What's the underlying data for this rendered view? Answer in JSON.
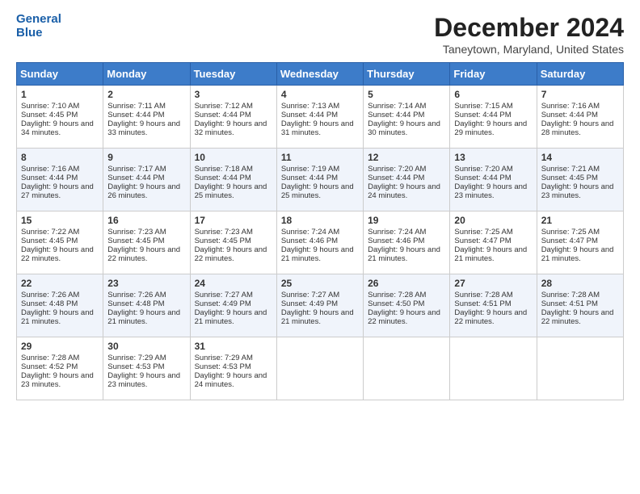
{
  "logo": {
    "line1": "General",
    "line2": "Blue"
  },
  "title": "December 2024",
  "location": "Taneytown, Maryland, United States",
  "days_of_week": [
    "Sunday",
    "Monday",
    "Tuesday",
    "Wednesday",
    "Thursday",
    "Friday",
    "Saturday"
  ],
  "weeks": [
    [
      {
        "day": 1,
        "sunrise": "7:10 AM",
        "sunset": "4:45 PM",
        "daylight": "9 hours and 34 minutes."
      },
      {
        "day": 2,
        "sunrise": "7:11 AM",
        "sunset": "4:44 PM",
        "daylight": "9 hours and 33 minutes."
      },
      {
        "day": 3,
        "sunrise": "7:12 AM",
        "sunset": "4:44 PM",
        "daylight": "9 hours and 32 minutes."
      },
      {
        "day": 4,
        "sunrise": "7:13 AM",
        "sunset": "4:44 PM",
        "daylight": "9 hours and 31 minutes."
      },
      {
        "day": 5,
        "sunrise": "7:14 AM",
        "sunset": "4:44 PM",
        "daylight": "9 hours and 30 minutes."
      },
      {
        "day": 6,
        "sunrise": "7:15 AM",
        "sunset": "4:44 PM",
        "daylight": "9 hours and 29 minutes."
      },
      {
        "day": 7,
        "sunrise": "7:16 AM",
        "sunset": "4:44 PM",
        "daylight": "9 hours and 28 minutes."
      }
    ],
    [
      {
        "day": 8,
        "sunrise": "7:16 AM",
        "sunset": "4:44 PM",
        "daylight": "9 hours and 27 minutes."
      },
      {
        "day": 9,
        "sunrise": "7:17 AM",
        "sunset": "4:44 PM",
        "daylight": "9 hours and 26 minutes."
      },
      {
        "day": 10,
        "sunrise": "7:18 AM",
        "sunset": "4:44 PM",
        "daylight": "9 hours and 25 minutes."
      },
      {
        "day": 11,
        "sunrise": "7:19 AM",
        "sunset": "4:44 PM",
        "daylight": "9 hours and 25 minutes."
      },
      {
        "day": 12,
        "sunrise": "7:20 AM",
        "sunset": "4:44 PM",
        "daylight": "9 hours and 24 minutes."
      },
      {
        "day": 13,
        "sunrise": "7:20 AM",
        "sunset": "4:44 PM",
        "daylight": "9 hours and 23 minutes."
      },
      {
        "day": 14,
        "sunrise": "7:21 AM",
        "sunset": "4:45 PM",
        "daylight": "9 hours and 23 minutes."
      }
    ],
    [
      {
        "day": 15,
        "sunrise": "7:22 AM",
        "sunset": "4:45 PM",
        "daylight": "9 hours and 22 minutes."
      },
      {
        "day": 16,
        "sunrise": "7:23 AM",
        "sunset": "4:45 PM",
        "daylight": "9 hours and 22 minutes."
      },
      {
        "day": 17,
        "sunrise": "7:23 AM",
        "sunset": "4:45 PM",
        "daylight": "9 hours and 22 minutes."
      },
      {
        "day": 18,
        "sunrise": "7:24 AM",
        "sunset": "4:46 PM",
        "daylight": "9 hours and 21 minutes."
      },
      {
        "day": 19,
        "sunrise": "7:24 AM",
        "sunset": "4:46 PM",
        "daylight": "9 hours and 21 minutes."
      },
      {
        "day": 20,
        "sunrise": "7:25 AM",
        "sunset": "4:47 PM",
        "daylight": "9 hours and 21 minutes."
      },
      {
        "day": 21,
        "sunrise": "7:25 AM",
        "sunset": "4:47 PM",
        "daylight": "9 hours and 21 minutes."
      }
    ],
    [
      {
        "day": 22,
        "sunrise": "7:26 AM",
        "sunset": "4:48 PM",
        "daylight": "9 hours and 21 minutes."
      },
      {
        "day": 23,
        "sunrise": "7:26 AM",
        "sunset": "4:48 PM",
        "daylight": "9 hours and 21 minutes."
      },
      {
        "day": 24,
        "sunrise": "7:27 AM",
        "sunset": "4:49 PM",
        "daylight": "9 hours and 21 minutes."
      },
      {
        "day": 25,
        "sunrise": "7:27 AM",
        "sunset": "4:49 PM",
        "daylight": "9 hours and 21 minutes."
      },
      {
        "day": 26,
        "sunrise": "7:28 AM",
        "sunset": "4:50 PM",
        "daylight": "9 hours and 22 minutes."
      },
      {
        "day": 27,
        "sunrise": "7:28 AM",
        "sunset": "4:51 PM",
        "daylight": "9 hours and 22 minutes."
      },
      {
        "day": 28,
        "sunrise": "7:28 AM",
        "sunset": "4:51 PM",
        "daylight": "9 hours and 22 minutes."
      }
    ],
    [
      {
        "day": 29,
        "sunrise": "7:28 AM",
        "sunset": "4:52 PM",
        "daylight": "9 hours and 23 minutes."
      },
      {
        "day": 30,
        "sunrise": "7:29 AM",
        "sunset": "4:53 PM",
        "daylight": "9 hours and 23 minutes."
      },
      {
        "day": 31,
        "sunrise": "7:29 AM",
        "sunset": "4:53 PM",
        "daylight": "9 hours and 24 minutes."
      },
      null,
      null,
      null,
      null
    ]
  ]
}
